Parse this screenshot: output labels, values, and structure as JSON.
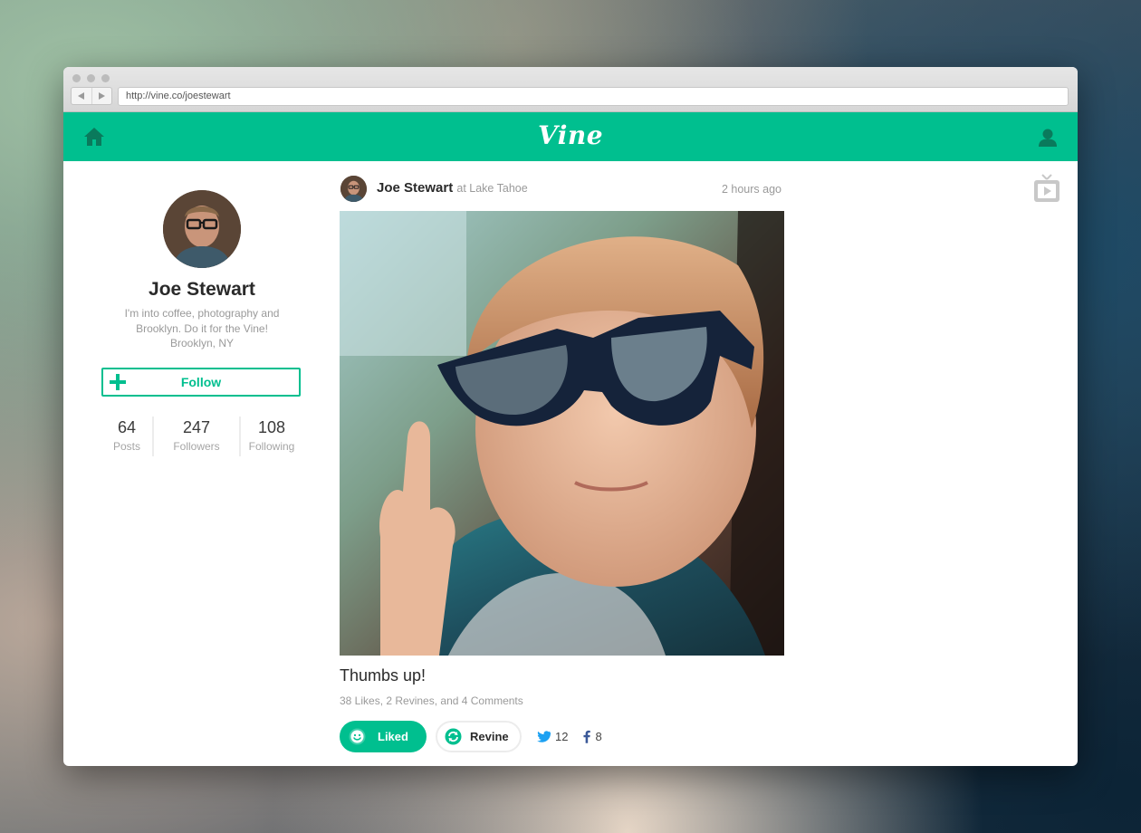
{
  "browser": {
    "url": "http://vine.co/joestewart"
  },
  "topbar": {
    "logo": "Vine",
    "brand_color": "#00bf8f"
  },
  "profile": {
    "name": "Joe Stewart",
    "bio_line1": "I'm into coffee, photography and",
    "bio_line2": "Brooklyn. Do it for the Vine!",
    "location": "Brooklyn, NY",
    "follow_label": "Follow",
    "stats": [
      {
        "value": "64",
        "label": "Posts"
      },
      {
        "value": "247",
        "label": "Followers"
      },
      {
        "value": "108",
        "label": "Following"
      }
    ]
  },
  "post": {
    "author": "Joe Stewart",
    "location": "at Lake Tahoe",
    "time": "2 hours ago",
    "caption": "Thumbs up!",
    "engagement": "38 Likes, 2 Revines, and 4 Comments",
    "liked_label": "Liked",
    "revine_label": "Revine",
    "twitter_count": "12",
    "facebook_count": "8"
  }
}
